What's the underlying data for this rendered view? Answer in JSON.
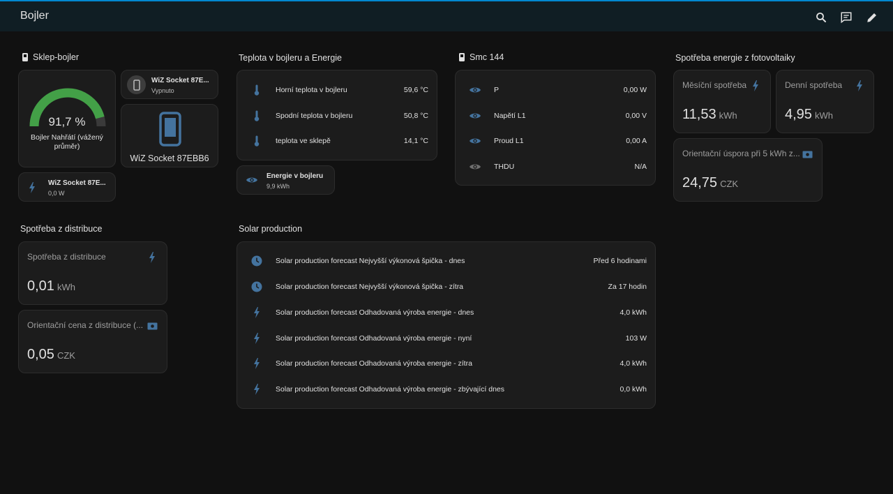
{
  "app": {
    "title": "Bojler"
  },
  "colors": {
    "accent": "#44739e",
    "gauge_green": "#43a047",
    "topbar_line": "#0288d1"
  },
  "icons": {
    "topbar": [
      "search-icon",
      "chat-icon",
      "pencil-icon"
    ]
  },
  "sklep": {
    "title": "Sklep-bojler",
    "gauge": {
      "value_text": "91,7 %",
      "value": 91.7,
      "label": "Bojler Nahřátí (vážený průměr)"
    },
    "socket_small": {
      "name": "WiZ Socket 87E...",
      "state": "Vypnuto"
    },
    "socket_big": {
      "name": "WiZ Socket 87EBB6"
    },
    "socket_power": {
      "name": "WiZ Socket 87E...",
      "state": "0,0 W"
    }
  },
  "teplota": {
    "title": "Teplota v bojleru a Energie",
    "rows": [
      {
        "label": "Horní teplota v bojleru",
        "value": "59,6 °C"
      },
      {
        "label": "Spodní teplota v bojleru",
        "value": "50,8 °C"
      },
      {
        "label": "teplota ve sklepě",
        "value": "14,1 °C"
      }
    ],
    "energie": {
      "name": "Energie v bojleru",
      "value": "9,9 kWh"
    }
  },
  "smc": {
    "title": "Smc 144",
    "rows": [
      {
        "label": "P",
        "value": "0,00 W"
      },
      {
        "label": "Napětí L1",
        "value": "0,00 V"
      },
      {
        "label": "Proud L1",
        "value": "0,00 A"
      },
      {
        "label": "THDU",
        "value": "N/A"
      }
    ]
  },
  "fve": {
    "title": "Spotřeba energie z fotovoltaiky",
    "monthly": {
      "name": "Měsíční spotřeba",
      "value": "11,53",
      "unit": "kWh"
    },
    "daily": {
      "name": "Denní spotřeba",
      "value": "4,95",
      "unit": "kWh"
    },
    "saving": {
      "name": "Orientační úspora při 5 kWh z...",
      "value": "24,75",
      "unit": "CZK"
    }
  },
  "distribuce": {
    "title": "Spotřeba z distribuce",
    "consumption": {
      "name": "Spotřeba z distribuce",
      "value": "0,01",
      "unit": "kWh"
    },
    "price": {
      "name": "Orientační cena z distribuce (...",
      "value": "0,05",
      "unit": "CZK"
    }
  },
  "solar": {
    "title": "Solar production",
    "rows": [
      {
        "label": "Solar production forecast Nejvyšší výkonová špička - dnes",
        "value": "Před 6 hodinami"
      },
      {
        "label": "Solar production forecast Nejvyšší výkonová špička - zítra",
        "value": "Za 17 hodin"
      },
      {
        "label": "Solar production forecast Odhadovaná výroba energie - dnes",
        "value": "4,0 kWh"
      },
      {
        "label": "Solar production forecast Odhadovaná výroba energie - nyní",
        "value": "103 W"
      },
      {
        "label": "Solar production forecast Odhadovaná výroba energie - zítra",
        "value": "4,0 kWh"
      },
      {
        "label": "Solar production forecast Odhadovaná výroba energie - zbývající dnes",
        "value": "0,0 kWh"
      }
    ]
  }
}
